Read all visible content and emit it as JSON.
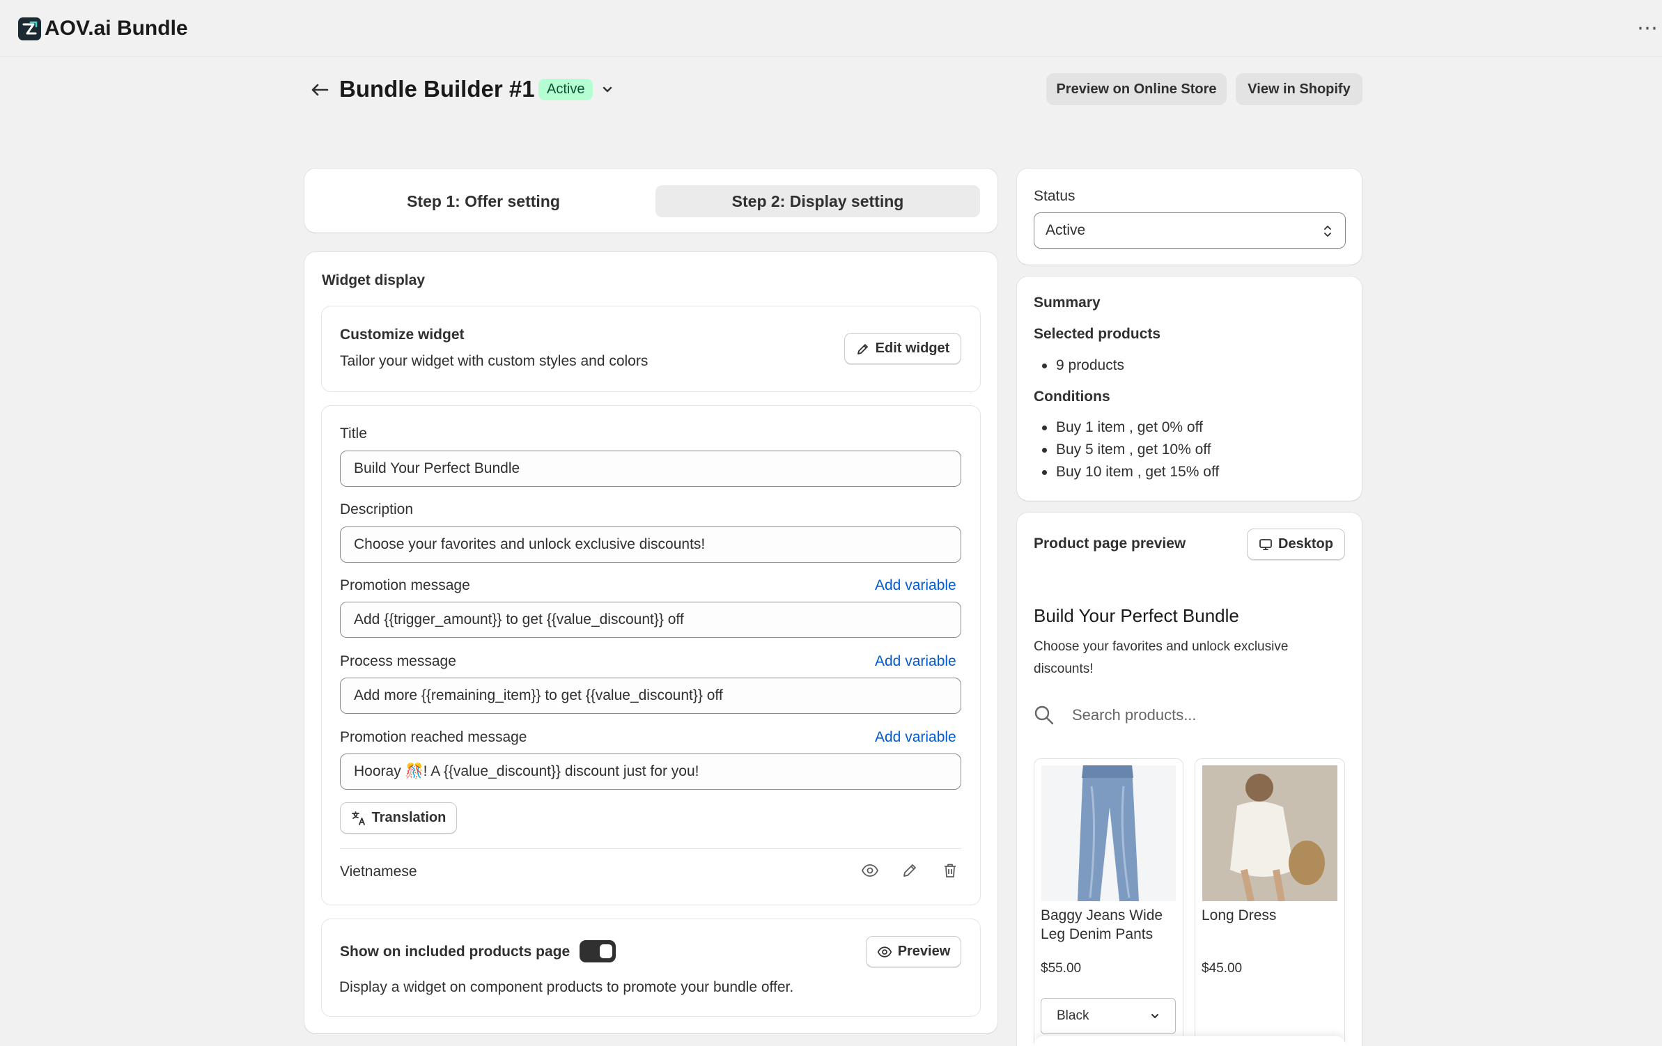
{
  "app": {
    "name": "AOV.ai Bundle",
    "more_icon": "ellipsis-icon"
  },
  "header": {
    "title": "Bundle Builder #1",
    "status_badge": "Active",
    "preview_button": "Preview on Online Store",
    "view_button": "View in Shopify"
  },
  "steps": [
    {
      "label": "Step 1: Offer setting",
      "active": false
    },
    {
      "label": "Step 2: Display setting",
      "active": true
    }
  ],
  "widget_display": {
    "title": "Widget display",
    "customize": {
      "heading": "Customize widget",
      "description": "Tailor your widget with custom styles and colors",
      "button": "Edit widget"
    },
    "fields": {
      "title_label": "Title",
      "title_value": "Build Your Perfect Bundle",
      "description_label": "Description",
      "description_value": "Choose your favorites and unlock exclusive discounts!",
      "promotion_label": "Promotion message",
      "promotion_value": "Add {{trigger_amount}} to get {{value_discount}} off",
      "process_label": "Process message",
      "process_value": "Add more {{remaining_item}} to get {{value_discount}} off",
      "reached_label": "Promotion reached message",
      "reached_value": "Hooray 🎊! A {{value_discount}} discount just for you!",
      "add_variable": "Add variable"
    },
    "translation_button": "Translation",
    "language": "Vietnamese",
    "show_on_products": {
      "label": "Show on included products page",
      "toggle_on": true,
      "preview_button": "Preview",
      "description": "Display a widget on component products to promote your bundle offer."
    }
  },
  "status_card": {
    "label": "Status",
    "value": "Active"
  },
  "summary": {
    "title": "Summary",
    "selected_heading": "Selected products",
    "selected_items": [
      "9 products"
    ],
    "conditions_heading": "Conditions",
    "conditions": [
      "Buy 1 item , get 0% off",
      "Buy 5 item , get 10% off",
      "Buy 10 item , get 15% off"
    ]
  },
  "preview": {
    "title": "Product page preview",
    "device_button": "Desktop",
    "bundle_title": "Build Your Perfect Bundle",
    "bundle_description": "Choose your favorites and unlock exclusive discounts!",
    "search_placeholder": "Search products...",
    "products": [
      {
        "name": "Baggy Jeans Wide Leg Denim Pants",
        "price": "$55.00",
        "variant": "Black"
      },
      {
        "name": "Long Dress",
        "price": "$45.00"
      }
    ]
  },
  "colors": {
    "badge_bg": "#b4fed2",
    "badge_text": "#0c5132",
    "link": "#005bd3",
    "background": "#f1f1f1"
  }
}
